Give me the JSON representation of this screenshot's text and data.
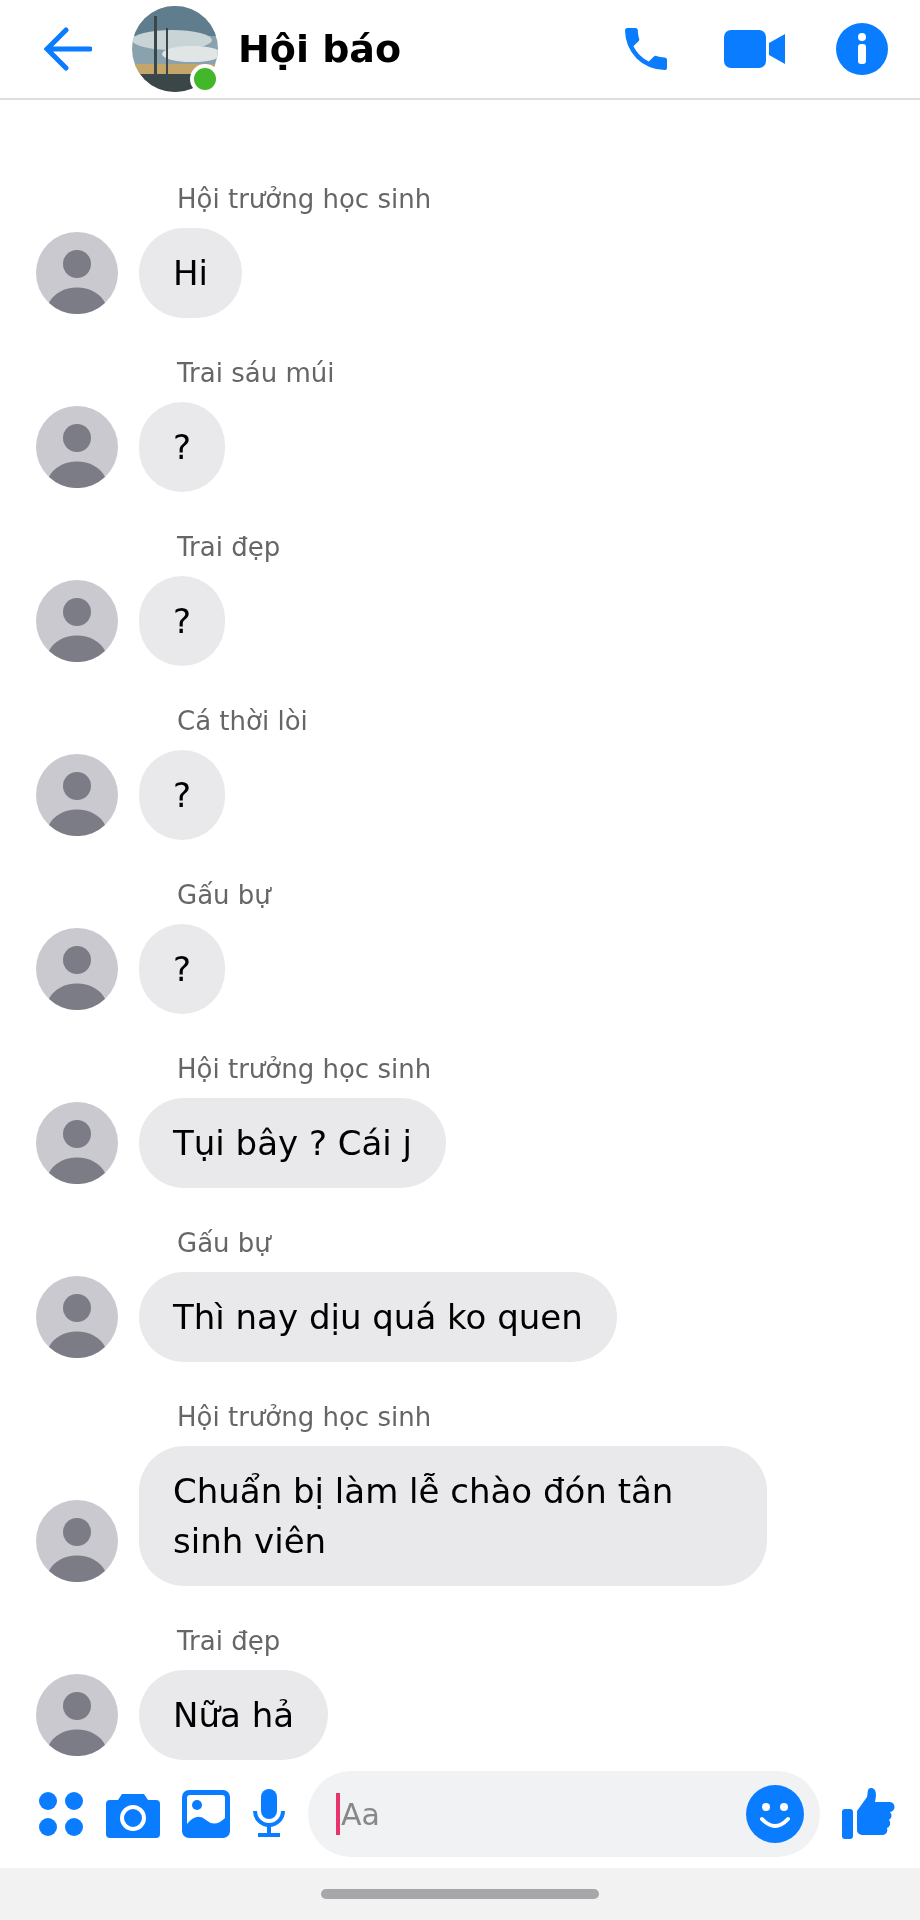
{
  "header": {
    "title": "Hội báo",
    "online": true
  },
  "messages": [
    {
      "sender": "Hội trưởng học sinh",
      "text": "Hi"
    },
    {
      "sender": "Trai sáu múi",
      "text": "?"
    },
    {
      "sender": "Trai đẹp",
      "text": "?"
    },
    {
      "sender": "Cá thời lòi",
      "text": "?"
    },
    {
      "sender": "Gấu bự",
      "text": "?"
    },
    {
      "sender": "Hội trưởng học sinh",
      "text": "Tụi bây ? Cái j"
    },
    {
      "sender": "Gấu bự",
      "text": "Thì nay dịu quá ko quen"
    },
    {
      "sender": "Hội trưởng học sinh",
      "text": "Chuẩn bị làm lễ chào đón tân sinh viên"
    },
    {
      "sender": "Trai đẹp",
      "text": "Nữa hả"
    }
  ],
  "composer": {
    "placeholder": "Aa"
  }
}
